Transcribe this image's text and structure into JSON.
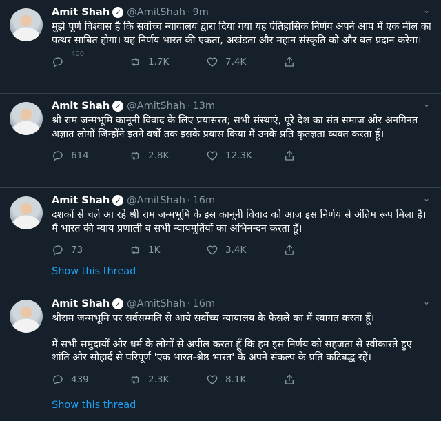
{
  "tweets": [
    {
      "name": "Amit Shah",
      "handle": "@AmitShah",
      "time": "9m",
      "paragraphs": [
        "मुझे पूर्ण विश्वास है कि सर्वोच्च न्यायालय द्वारा दिया गया यह ऐतिहासिक निर्णय अपने आप में एक मील का पत्थर साबित होगा। यह निर्णय भारत की एकता, अखंडता और महान संस्कृति को और बल प्रदान करेगा।"
      ],
      "replies": "400",
      "retweets": "1.7K",
      "likes": "7.4K"
    },
    {
      "name": "Amit Shah",
      "handle": "@AmitShah",
      "time": "13m",
      "paragraphs": [
        "श्री राम जन्मभूमि कानूनी विवाद के लिए प्रयासरत; सभी संस्थाएं, पूरे देश का संत समाज और अनगिनत अज्ञात लोगों जिन्होंने इतने वर्षों तक इसके प्रयास किया मैं उनके प्रति कृतज्ञता व्यक्त करता हूँ।"
      ],
      "replies": "614",
      "retweets": "2.8K",
      "likes": "12.3K"
    },
    {
      "name": "Amit Shah",
      "handle": "@AmitShah",
      "time": "16m",
      "paragraphs": [
        "दशकों से चले आ रहे श्री राम जन्मभूमि के इस कानूनी विवाद को आज इस निर्णय से अंतिम रूप मिला है। मैं भारत की न्याय प्रणाली व सभी न्यायमूर्तियों का अभिनन्दन करता हूँ।"
      ],
      "replies": "73",
      "retweets": "1K",
      "likes": "3.4K",
      "thread_link": "Show this thread"
    },
    {
      "name": "Amit Shah",
      "handle": "@AmitShah",
      "time": "16m",
      "paragraphs": [
        "श्रीराम जन्मभूमि पर सर्वसम्मति से आये सर्वोच्च न्यायालय के फैसले का मैं स्वागत करता हूँ।",
        "मैं सभी समुदायों और धर्म के लोगों से अपील करता हूँ कि हम इस निर्णय को सहजता से स्वीकारते हुए शांति और सौहार्द से परिपूर्ण 'एक भारत-श्रेष्ठ भारत' के अपने संकल्प के प्रति कटिबद्ध रहें।"
      ],
      "replies": "439",
      "retweets": "2.3K",
      "likes": "8.1K",
      "thread_link": "Show this thread"
    }
  ],
  "colors": {
    "background": "#15202b",
    "secondary_text": "#8899a6",
    "link": "#1da1f2",
    "divider": "#38444d"
  },
  "icons": {
    "reply": "reply-icon",
    "retweet": "retweet-icon",
    "like": "like-icon",
    "share": "share-icon",
    "verified": "verified-badge-icon",
    "caret": "chevron-down-icon"
  }
}
